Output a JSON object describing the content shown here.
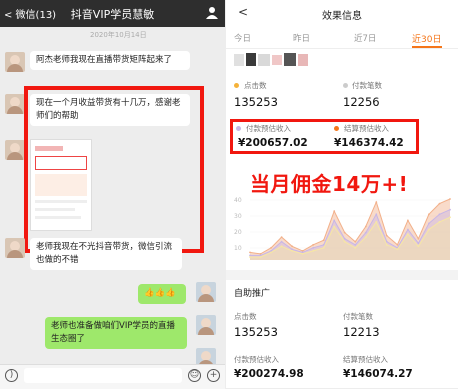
{
  "chat": {
    "back_label": "< 微信(13)",
    "title": "抖音VIP学员慧敏",
    "date": "2020年10月14日",
    "messages": [
      {
        "side": "left",
        "text": "阿杰老师我现在直播带货矩阵起来了"
      },
      {
        "side": "left",
        "text": "现在一个月收益带货有十几万，感谢老师们的帮助"
      },
      {
        "side": "left",
        "image": "screenshot-thumbnail"
      },
      {
        "side": "left",
        "text": "老师我现在不光抖音带货，微信引流也做的不错"
      },
      {
        "side": "right",
        "text": "👍👍👍"
      },
      {
        "side": "right",
        "text": "老师也准备做咱们VIP学员的直播生态圈了"
      }
    ]
  },
  "stats": {
    "title": "效果信息",
    "tabs": [
      "今日",
      "昨日",
      "近7日",
      "近30日"
    ],
    "active_tab": "近30日",
    "top": {
      "clicks_label": "点击数",
      "clicks": "135253",
      "pay_count_label": "付款笔数",
      "pay_count": "12256",
      "pay_income_label": "付款预估收入",
      "pay_income": "¥200657.02",
      "settle_income_label": "结算预估收入",
      "settle_income": "¥146374.42"
    },
    "overlay": "当月佣金14万+!",
    "chart_ticks": [
      "40",
      "30",
      "20",
      "10"
    ],
    "section_title": "自助推广",
    "bottom": {
      "clicks_label": "点击数",
      "clicks": "135253",
      "pay_count_label": "付款笔数",
      "pay_count": "12213",
      "pay_income_label": "付款预估收入",
      "pay_income": "¥200274.98",
      "settle_income_label": "结算预估收入",
      "settle_income": "¥146074.27"
    }
  },
  "chart_data": {
    "type": "area",
    "series": [
      {
        "color": "#f2b08a",
        "values": [
          5,
          4,
          8,
          15,
          9,
          6,
          10,
          13,
          32,
          18,
          12,
          22,
          38,
          16,
          10,
          26,
          14,
          30,
          37,
          40
        ]
      },
      {
        "color": "#c7b6e6",
        "values": [
          3,
          3,
          6,
          12,
          7,
          5,
          8,
          10,
          26,
          14,
          10,
          18,
          30,
          12,
          8,
          20,
          11,
          24,
          30,
          33
        ]
      },
      {
        "color": "#f7e7a3",
        "values": [
          2,
          2,
          5,
          9,
          6,
          4,
          6,
          8,
          22,
          12,
          8,
          15,
          25,
          10,
          7,
          17,
          9,
          20,
          25,
          28
        ]
      }
    ],
    "ylim": [
      0,
      42
    ]
  },
  "colors": {
    "accent": "#f5761a",
    "frame": "#f1170f",
    "header": "#2e2e2e",
    "bubble_right": "#9ee86b"
  }
}
